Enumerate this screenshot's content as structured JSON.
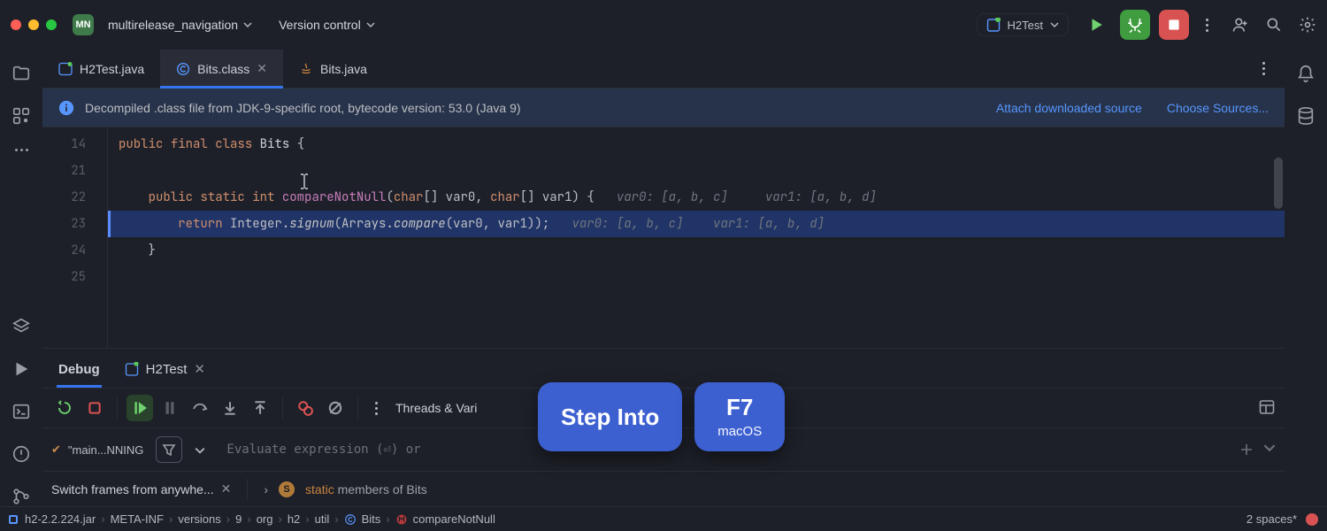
{
  "header": {
    "project_initials": "MN",
    "project_name": "multirelease_navigation",
    "vcs_label": "Version control",
    "run_config": "H2Test"
  },
  "tabs": [
    {
      "label": "H2Test.java",
      "active": false,
      "closeable": false
    },
    {
      "label": "Bits.class",
      "active": true,
      "closeable": true
    },
    {
      "label": "Bits.java",
      "active": false,
      "closeable": false
    }
  ],
  "banner": {
    "text": "Decompiled .class file from JDK-9-specific root, bytecode version: 53.0 (Java 9)",
    "link1": "Attach downloaded source",
    "link2": "Choose Sources..."
  },
  "editor": {
    "lines": [
      "14",
      "21",
      "22",
      "23",
      "24",
      "25"
    ],
    "l14": {
      "kw1": "public",
      "kw2": "final",
      "kw3": "class",
      "cls": "Bits",
      "br": " {"
    },
    "l22": {
      "kw1": "public",
      "kw2": "static",
      "type": "int",
      "mth": "compareNotNull",
      "sig": "(",
      "t1": "char",
      "p1": "[] var0, ",
      "t2": "char",
      "p2": "[] var1) {",
      "hint": "   var0: [a, b, c]     var1: [a, b, d]"
    },
    "l23": {
      "kw": "return",
      "call": " Integer.",
      "mth": "signum",
      "open": "(Arrays.",
      "mth2": "compare",
      "rest": "(var0, var1));",
      "hint": "   var0: [a, b, c]    var1: [a, b, d]"
    },
    "l24": "    }"
  },
  "debug": {
    "tab_main": "Debug",
    "tab_run": "H2Test",
    "toolbar_section": "Threads & Vari",
    "thread_chip": "\"main...NNING",
    "eval_placeholder": "Evaluate expression (⏎) or",
    "frames_hint": "Switch frames from anywhe...",
    "static_label_prefix": "static",
    "static_label_rest": " members of Bits"
  },
  "breadcrumbs": [
    "h2-2.2.224.jar",
    "META-INF",
    "versions",
    "9",
    "org",
    "h2",
    "util",
    "Bits",
    "compareNotNull"
  ],
  "status": {
    "indent": "2 spaces*"
  },
  "overlay": {
    "action": "Step Into",
    "key": "F7",
    "os": "macOS"
  }
}
